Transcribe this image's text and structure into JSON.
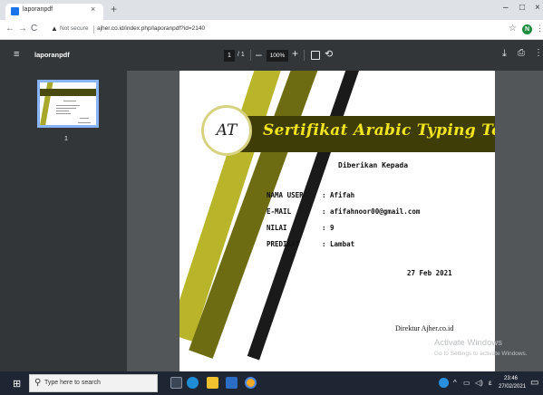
{
  "browser": {
    "tab_title": "laporanpdf",
    "tab_close": "×",
    "new_tab": "+",
    "back": "←",
    "forward": "→",
    "reload": "C",
    "warning_glyph": "▲",
    "not_secure": "Not secure",
    "url": "ajher.co.id/index.php/laporanpdf?id=2140",
    "star": "☆",
    "profile_initial": "N",
    "menu": "⋮",
    "minimize": "–",
    "restore": "□",
    "close": "×"
  },
  "viewer": {
    "menu_glyph": "≡",
    "title": "laporanpdf",
    "page_current": "1",
    "page_total": "/ 1",
    "zoom_minus": "–",
    "zoom": "100%",
    "zoom_plus": "+",
    "rotate": "⟲",
    "download": "⤓",
    "print": "⎙",
    "more": "⋮",
    "thumbnail_number": "1"
  },
  "certificate": {
    "seal_text": "AT",
    "title": "Sertifikat Arabic Typing Test",
    "subtitle": "Diberikan Kepada",
    "fields": [
      {
        "label": "NAMA USER",
        "value": ": Afifah"
      },
      {
        "label": "E-MAIL",
        "value": ": afifahnoor00@gmail.com"
      },
      {
        "label": "NILAI",
        "value": ": 9"
      },
      {
        "label": "PREDIKAT",
        "value": ": Lambat"
      }
    ],
    "date": "27 Feb 2021",
    "signature": "Direktur Ajher.co.id"
  },
  "watermark": {
    "line1": "Activate Windows",
    "line2": "Go to Settings to activate Windows."
  },
  "taskbar": {
    "start": "⊞",
    "search_glyph": "⚲",
    "search_placeholder": "Type here to search",
    "tray_up": "^",
    "tray_net": "▭",
    "tray_sound": "◁)",
    "tray_lang": "ε",
    "time": "23:46",
    "date": "27/02/2021",
    "notification": "▭"
  },
  "colors": {
    "olive_dark": "#3e3d08",
    "olive_light": "#b9b52a",
    "title_yellow": "#f2e41d",
    "viewer_bg": "#525659",
    "viewer_bar": "#323639"
  }
}
